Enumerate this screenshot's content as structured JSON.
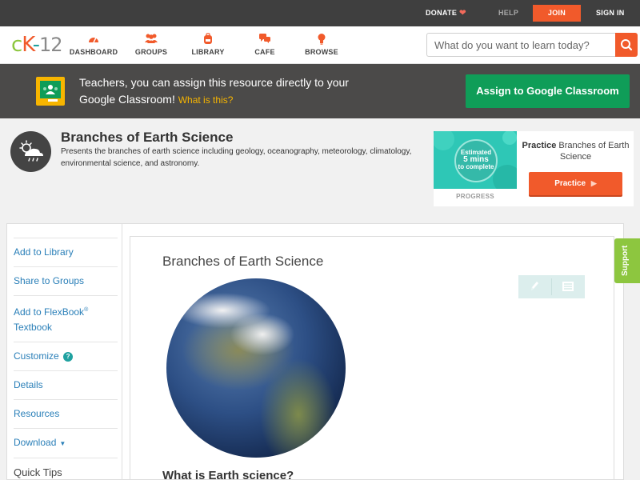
{
  "topbar": {
    "donate_label": "DONATE",
    "help_label": "HELP",
    "join_label": "JOIN",
    "signin_label": "SIGN IN"
  },
  "nav": {
    "logo_c": "c",
    "logo_k": "K",
    "logo_dash": "-",
    "logo_12": "12",
    "items": [
      {
        "label": "DASHBOARD",
        "icon": "dashboard-gauge-icon"
      },
      {
        "label": "GROUPS",
        "icon": "groups-people-icon"
      },
      {
        "label": "LIBRARY",
        "icon": "library-backpack-icon"
      },
      {
        "label": "CAFE",
        "icon": "cafe-chat-icon"
      },
      {
        "label": "BROWSE",
        "icon": "browse-lightbulb-icon"
      }
    ],
    "search_placeholder": "What do you want to learn today?",
    "search_icon": "search-icon"
  },
  "banner": {
    "text": "Teachers, you can assign this resource directly to your Google Classroom!",
    "whatis_label": "What is this?",
    "assign_label": "Assign to Google Classroom",
    "icon": "google-classroom-icon"
  },
  "resource": {
    "title": "Branches of Earth Science",
    "description": "Presents the branches of earth science including geology, oceanography, meteorology, climatology, environmental science, and astronomy.",
    "icon": "weather-cloud-sun-icon"
  },
  "practice": {
    "estimated_line1": "Estimated",
    "estimated_mins": "5 mins",
    "estimated_line3": "to complete",
    "progress_label": "PROGRESS",
    "heading_bold": "Practice",
    "heading_rest": " Branches of Earth Science",
    "button_label": "Practice"
  },
  "sidebar": {
    "items": [
      {
        "label": "Add to Library"
      },
      {
        "label": "Share to Groups"
      },
      {
        "label": "Add to FlexBook",
        "sup": "®",
        "line2": "Textbook"
      },
      {
        "label": "Customize"
      },
      {
        "label": "Details"
      },
      {
        "label": "Resources"
      },
      {
        "label": "Download"
      },
      {
        "label": "Quick Tips"
      }
    ]
  },
  "article": {
    "title": "Branches of Earth Science",
    "section_heading": "What is Earth science?",
    "tools": [
      "pencil-edit-icon",
      "notes-list-icon"
    ]
  },
  "support_label": "Support"
}
